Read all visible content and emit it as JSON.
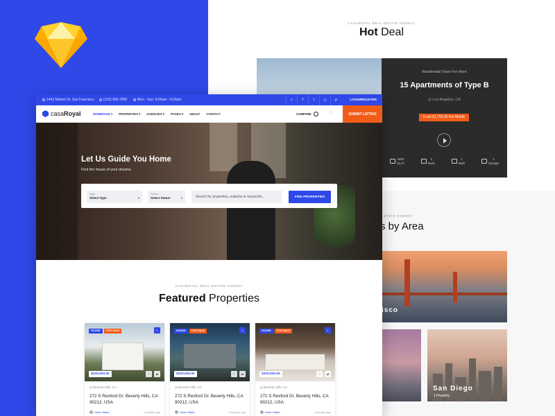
{
  "topbar": {
    "address": "1441 Market St, San Francisco",
    "phone": "(123) 456-7890",
    "hours": "Mon - Sun: 8:00am - 6:00pm",
    "login": "LOGIN/REGISTER"
  },
  "nav": {
    "logo_light": "casa",
    "logo_bold": "Royal",
    "links": [
      "HOMEPAGE ▾",
      "PROPERTIES ▾",
      "AGENCIES ▾",
      "PAGES ▾",
      "ABOUT",
      "CONTACT"
    ],
    "compare": "COMPARE",
    "submit": "SUBMIT LISTING"
  },
  "hero": {
    "title": "Let Us Guide You Home",
    "subtitle": "Find the house of your dreams",
    "type_label": "Type",
    "type_value": "Select Type",
    "status_label": "Status",
    "status_value": "Select Status",
    "search_placeholder": "Search for properties, suburbs or keywords...",
    "find_button": "FIND PROPERTIES"
  },
  "featured": {
    "agency": "CASAROYAL REAL ESTATE AGENCY",
    "title_bold": "Featured",
    "title_rest": " Properties"
  },
  "cards": [
    {
      "badge1": "HOUSE",
      "badge2": "FOR SALE",
      "num": "1",
      "price": "$320,000.00",
      "location": "Beverly Hills, CA",
      "address": "272 S Rexford Dr, Beverly Hills, CA 90212, USA",
      "agent": "Helen Matts",
      "ago": "4 months ago"
    },
    {
      "badge1": "HOUSE",
      "badge2": "FOR SALE",
      "num": "1",
      "price": "$320,000.00",
      "location": "Beverly Hills, CA",
      "address": "272 S Rexford Dr, Beverly Hills, CA 90212, USA",
      "agent": "Helen Matts",
      "ago": "4 months ago"
    },
    {
      "badge1": "HOUSE",
      "badge2": "FOR SALE",
      "num": "1",
      "price": "$320,000.00",
      "location": "Beverly Hills, CA",
      "address": "272 S Rexford Dr, Beverly Hills, CA 90212, USA",
      "agent": "Helen Matts",
      "ago": "4 months ago"
    }
  ],
  "hotdeal": {
    "agency": "CASAROYAL REAL ESTATE AGENCY",
    "title_bold": "Hot",
    "title_rest": " Deal",
    "subtitle": "Residential Towe For Rent",
    "name": "15 Apartments of Type B",
    "location": "Los Angeles, CA",
    "price": "From $1,700.00 Per Month",
    "features": [
      {
        "value": "1600",
        "unit": "Sq Ft"
      },
      {
        "value": "2",
        "unit": "Beds"
      },
      {
        "value": "1",
        "unit": "Bath"
      },
      {
        "value": "1",
        "unit": "Garage"
      }
    ]
  },
  "area": {
    "agency": "STATE AGENCY",
    "title": "s by Area",
    "sf_label": "isco",
    "sd_label": "San Diego",
    "sd_sub": "1 Property"
  },
  "colors": {
    "blue": "#2f48e8",
    "orange": "#f25c19"
  }
}
